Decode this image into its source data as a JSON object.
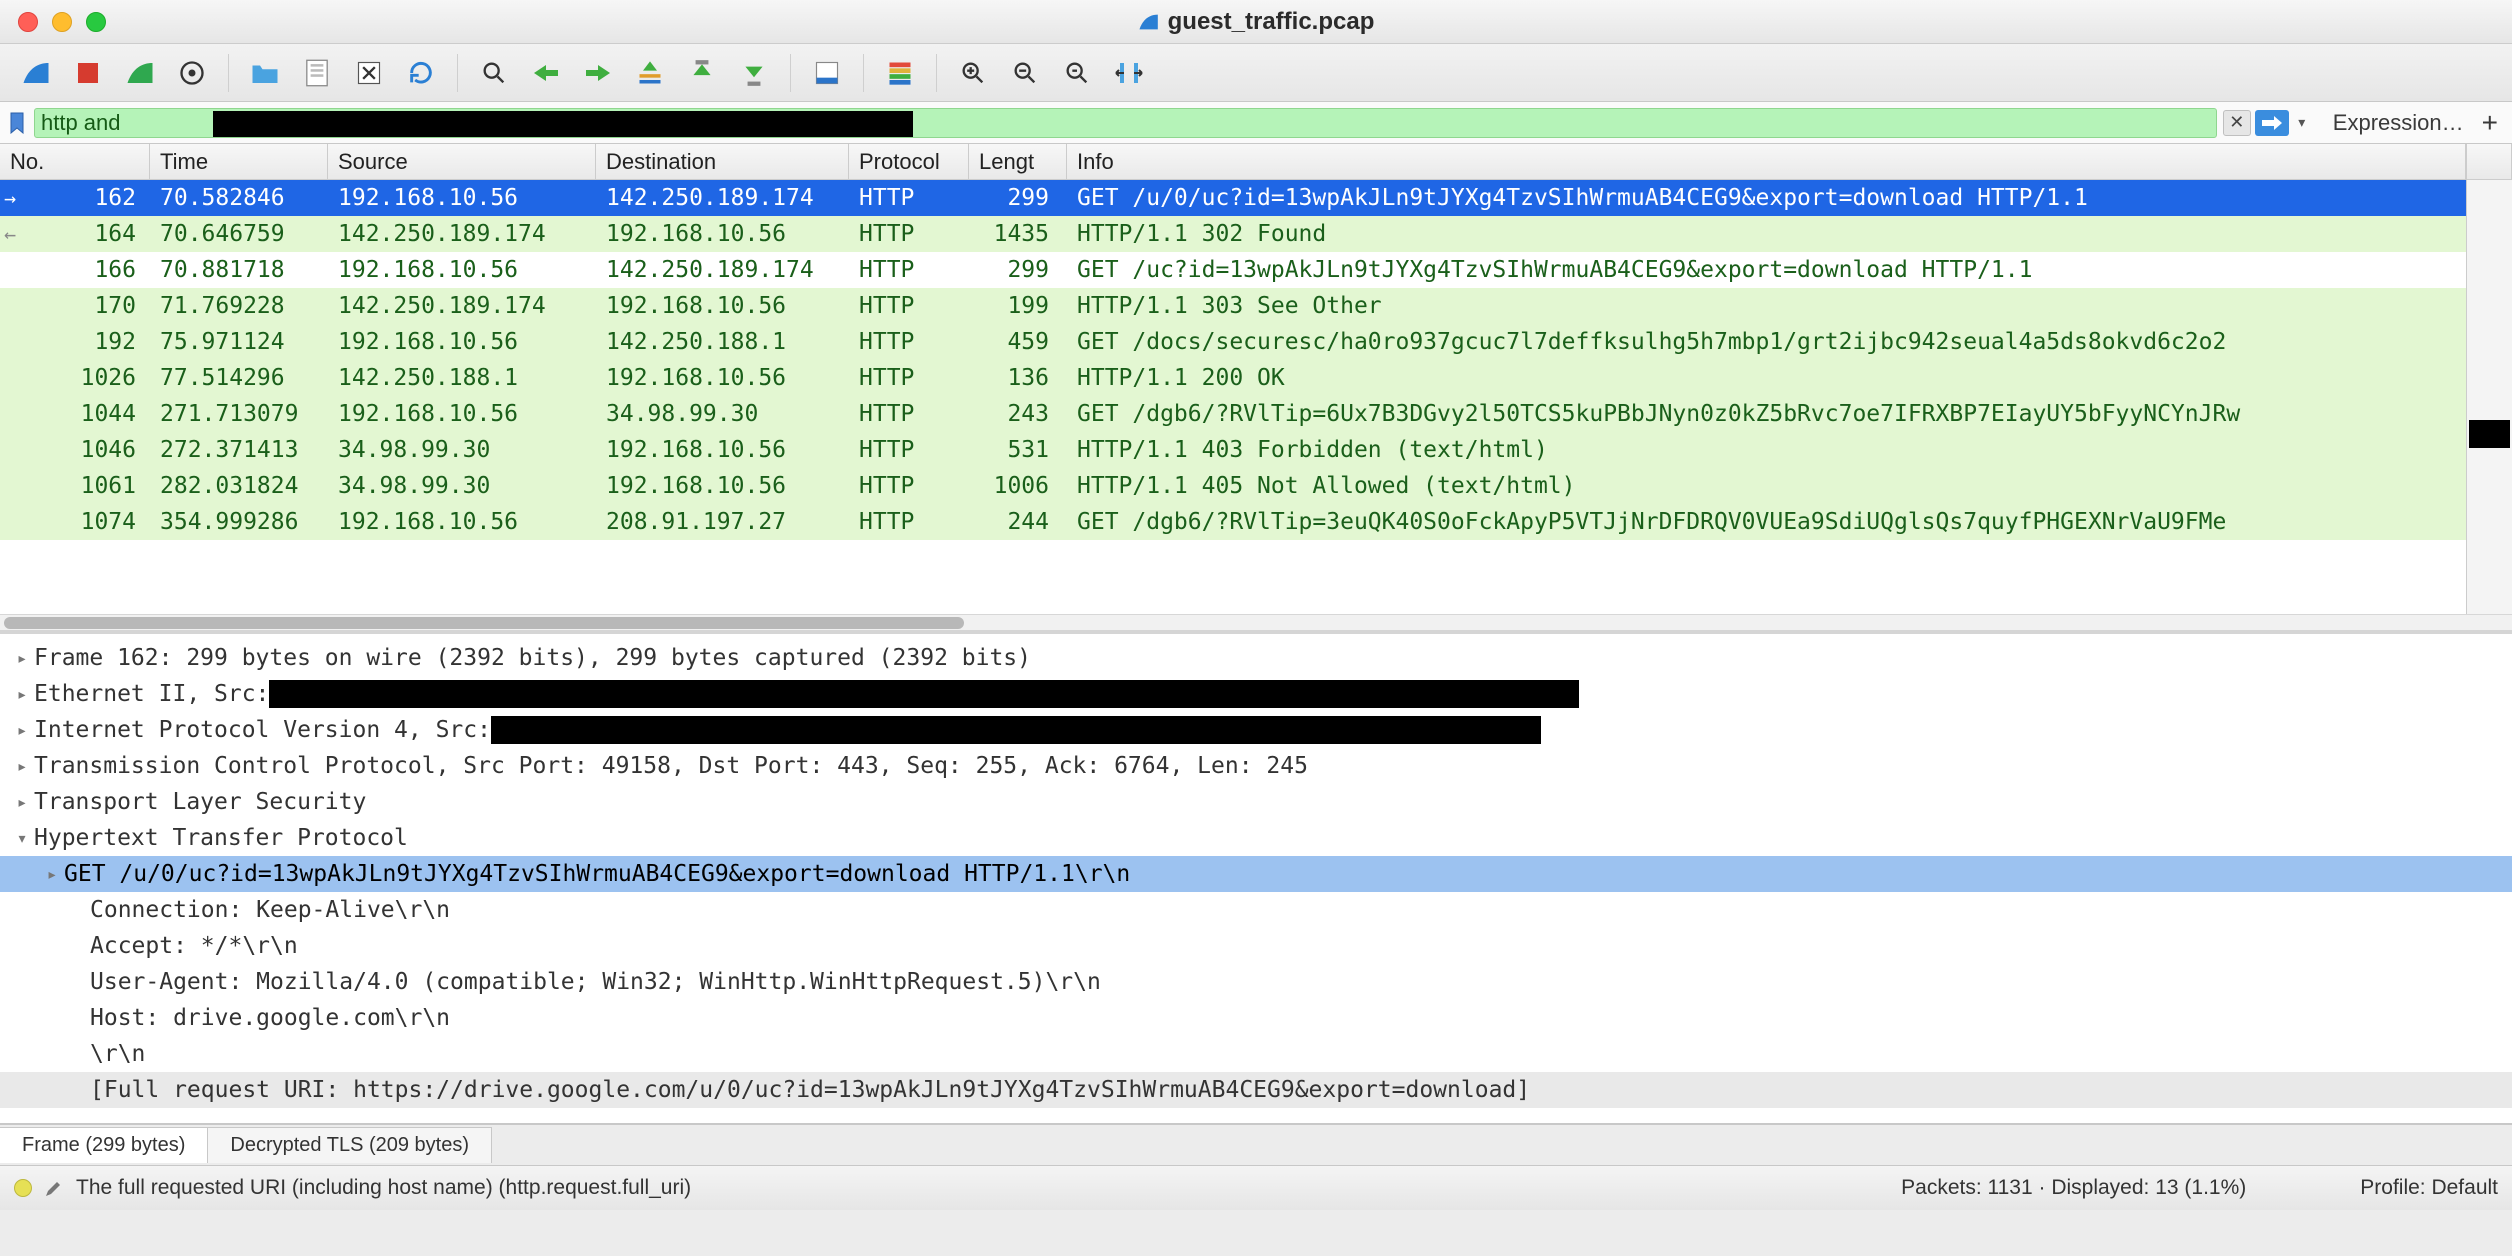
{
  "window": {
    "title": "guest_traffic.pcap"
  },
  "filter": {
    "text": "http and ",
    "expression_label": "Expression…"
  },
  "columns": {
    "no": "No.",
    "time": "Time",
    "source": "Source",
    "destination": "Destination",
    "protocol": "Protocol",
    "length": "Lengt",
    "info": "Info"
  },
  "packets": [
    {
      "no": "162",
      "time": "70.582846",
      "src": "192.168.10.56",
      "dst": "142.250.189.174",
      "proto": "HTTP",
      "len": "299",
      "info": "GET /u/0/uc?id=13wpAkJLn9tJYXg4TzvSIhWrmuAB4CEG9&export=download HTTP/1.1",
      "selected": true,
      "mark": "→"
    },
    {
      "no": "164",
      "time": "70.646759",
      "src": "142.250.189.174",
      "dst": "192.168.10.56",
      "proto": "HTTP",
      "len": "1435",
      "info": "HTTP/1.1 302 Found",
      "mark": "←"
    },
    {
      "no": "166",
      "time": "70.881718",
      "src": "192.168.10.56",
      "dst": "142.250.189.174",
      "proto": "HTTP",
      "len": "299",
      "info": "GET /uc?id=13wpAkJLn9tJYXg4TzvSIhWrmuAB4CEG9&export=download HTTP/1.1",
      "cls": "wht"
    },
    {
      "no": "170",
      "time": "71.769228",
      "src": "142.250.189.174",
      "dst": "192.168.10.56",
      "proto": "HTTP",
      "len": "199",
      "info": "HTTP/1.1 303 See Other"
    },
    {
      "no": "192",
      "time": "75.971124",
      "src": "192.168.10.56",
      "dst": "142.250.188.1",
      "proto": "HTTP",
      "len": "459",
      "info": "GET /docs/securesc/ha0ro937gcuc7l7deffksulhg5h7mbp1/grt2ijbc942seual4a5ds8okvd6c2o2"
    },
    {
      "no": "1026",
      "time": "77.514296",
      "src": "142.250.188.1",
      "dst": "192.168.10.56",
      "proto": "HTTP",
      "len": "136",
      "info": "HTTP/1.1 200 OK"
    },
    {
      "no": "1044",
      "time": "271.713079",
      "src": "192.168.10.56",
      "dst": "34.98.99.30",
      "proto": "HTTP",
      "len": "243",
      "info": "GET /dgb6/?RVlTip=6Ux7B3DGvy2l50TCS5kuPBbJNyn0z0kZ5bRvc7oe7IFRXBP7EIayUY5bFyyNCYnJRw"
    },
    {
      "no": "1046",
      "time": "272.371413",
      "src": "34.98.99.30",
      "dst": "192.168.10.56",
      "proto": "HTTP",
      "len": "531",
      "info": "HTTP/1.1 403 Forbidden  (text/html)"
    },
    {
      "no": "1061",
      "time": "282.031824",
      "src": "34.98.99.30",
      "dst": "192.168.10.56",
      "proto": "HTTP",
      "len": "1006",
      "info": "HTTP/1.1 405 Not Allowed  (text/html)"
    },
    {
      "no": "1074",
      "time": "354.999286",
      "src": "192.168.10.56",
      "dst": "208.91.197.27",
      "proto": "HTTP",
      "len": "244",
      "info": "GET /dgb6/?RVlTip=3euQK40S0oFckApyP5VTJjNrDFDRQV0VUEa9SdiUQglsQs7quyfPHGEXNrVaU9FMe"
    }
  ],
  "details": {
    "frame": "Frame 162: 299 bytes on wire (2392 bits), 299 bytes captured (2392 bits)",
    "eth_pre": "Ethernet II, Src: ",
    "ip_pre": "Internet Protocol Version 4, Src: ",
    "tcp": "Transmission Control Protocol, Src Port: 49158, Dst Port: 443, Seq: 255, Ack: 6764, Len: 245",
    "tls": "Transport Layer Security",
    "http": "Hypertext Transfer Protocol",
    "req": "GET /u/0/uc?id=13wpAkJLn9tJYXg4TzvSIhWrmuAB4CEG9&export=download HTTP/1.1\\r\\n",
    "h_conn": "Connection: Keep-Alive\\r\\n",
    "h_accept": "Accept: */*\\r\\n",
    "h_ua": "User-Agent: Mozilla/4.0 (compatible; Win32; WinHttp.WinHttpRequest.5)\\r\\n",
    "h_host": "Host: drive.google.com\\r\\n",
    "h_blank": "\\r\\n",
    "h_full": "[Full request URI: https://drive.google.com/u/0/uc?id=13wpAkJLn9tJYXg4TzvSIhWrmuAB4CEG9&export=download]"
  },
  "bytes_tabs": {
    "frame": "Frame (299 bytes)",
    "tls": "Decrypted TLS (209 bytes)"
  },
  "status": {
    "hint": "The full requested URI (including host name) (http.request.full_uri)",
    "packets": "Packets: 1131 · Displayed: 13 (1.1%)",
    "profile": "Profile: Default"
  },
  "toolbar_icons": [
    {
      "name": "shark-fin-icon"
    },
    {
      "name": "stop-capture-icon"
    },
    {
      "name": "restart-capture-icon"
    },
    {
      "name": "capture-options-icon"
    },
    {
      "sep": true
    },
    {
      "name": "open-file-icon"
    },
    {
      "name": "save-file-icon"
    },
    {
      "name": "close-file-icon"
    },
    {
      "name": "reload-icon"
    },
    {
      "sep": true
    },
    {
      "name": "find-icon"
    },
    {
      "name": "go-back-icon"
    },
    {
      "name": "go-forward-icon"
    },
    {
      "name": "go-to-packet-icon"
    },
    {
      "name": "go-first-icon"
    },
    {
      "name": "go-last-icon"
    },
    {
      "sep": true
    },
    {
      "name": "auto-scroll-icon"
    },
    {
      "sep": true
    },
    {
      "name": "colorize-icon"
    },
    {
      "sep": true
    },
    {
      "name": "zoom-in-icon"
    },
    {
      "name": "zoom-out-icon"
    },
    {
      "name": "zoom-reset-icon"
    },
    {
      "name": "resize-columns-icon"
    }
  ]
}
